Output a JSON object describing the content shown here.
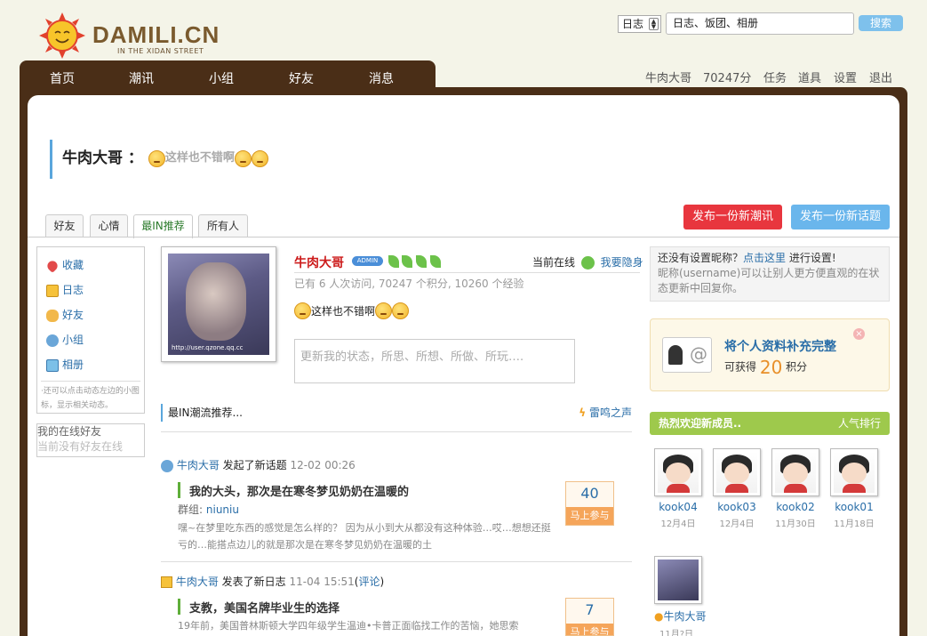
{
  "header": {
    "logo_text": "DAMILI.CN",
    "logo_sub": "IN THE XIDAN STREET",
    "search_type": "日志",
    "search_value": "日志、饭团、相册",
    "search_button": "搜索"
  },
  "nav": {
    "items": [
      {
        "label": "首页"
      },
      {
        "label": "潮讯"
      },
      {
        "label": "小组"
      },
      {
        "label": "好友"
      },
      {
        "label": "消息"
      }
    ]
  },
  "user_links": {
    "username": "牛肉大哥",
    "points": "70247分",
    "tasks": "任务",
    "props": "道具",
    "settings": "设置",
    "logout": "退出"
  },
  "profile_header": {
    "name": "牛肉大哥",
    "colon": "：",
    "status_text": "这样也不错啊"
  },
  "tabs": [
    {
      "label": "好友"
    },
    {
      "label": "心情"
    },
    {
      "label": "最IN推荐"
    },
    {
      "label": "所有人"
    }
  ],
  "buttons": {
    "post_news": "发布一份新潮讯",
    "post_topic": "发布一份新话题"
  },
  "left_menu": {
    "items": [
      {
        "label": "收藏",
        "icon": "heart-icon"
      },
      {
        "label": "日志",
        "icon": "notebook-icon"
      },
      {
        "label": "好友",
        "icon": "handshake-icon"
      },
      {
        "label": "小组",
        "icon": "group-icon"
      },
      {
        "label": "相册",
        "icon": "photo-icon"
      }
    ],
    "note": "·还可以点击动态左边的小图标，显示相关动态。"
  },
  "online_friends": {
    "title": "我的在线好友",
    "empty": "当前没有好友在线"
  },
  "profile": {
    "name": "牛肉大哥",
    "badge": "ADMIN",
    "stats": "已有 6 人次访问, 70247 个积分, 10260 个经验",
    "online_label": "当前在线",
    "hide_link": "我要隐身",
    "status": "这样也不错啊",
    "status_placeholder": "更新我的状态，所思、所想、所做、所玩….",
    "avatar_caption": "http://user.qzone.qq.cc"
  },
  "feed": {
    "title": "最IN潮流推荐...",
    "right_link": "雷鸣之声",
    "items": [
      {
        "user": "牛肉大哥",
        "action": "发起了新话题",
        "time": "12-02 00:26",
        "title": "我的大头，那次是在寒冬梦见奶奶在温暖的",
        "group_label": "群组:",
        "group": "niuniu",
        "excerpt": "嘿~在梦里吃东西的感觉是怎么样的？ 因为从小到大从都没有这种体验…哎…想想还挺亏的…能搭点边儿的就是那次是在寒冬梦见奶奶在温暖的土",
        "votes": "40",
        "vote_label": "马上参与"
      },
      {
        "user": "牛肉大哥",
        "action": "发表了新日志",
        "time": "11-04 15:51",
        "comment_open": "(",
        "comment": "评论",
        "comment_close": ")",
        "title": "支教，美国名牌毕业生的选择",
        "excerpt": "19年前，美国普林斯顿大学四年级学生温迪•卡普正面临找工作的苦恼，她思索",
        "votes": "7",
        "vote_label": "马上参与"
      }
    ]
  },
  "sidebar": {
    "nickname_notice_a": "还没有设置昵称？",
    "nickname_link": "点击这里",
    "nickname_notice_b": "进行设置!",
    "nickname_desc": "昵称(username)可以让别人更方便直观的在状态更新中回复你。",
    "complete_title": "将个人资料补充完整",
    "complete_reward_a": "可获得",
    "complete_points": "20",
    "complete_reward_b": "积分",
    "new_members_title": "热烈欢迎新成员..",
    "popularity_link": "人气排行",
    "members": [
      {
        "name": "kook04",
        "date": "12月4日"
      },
      {
        "name": "kook03",
        "date": "12月4日"
      },
      {
        "name": "kook02",
        "date": "11月30日"
      },
      {
        "name": "kook01",
        "date": "11月18日"
      },
      {
        "name": "牛肉大哥",
        "date": "11月?日"
      }
    ]
  },
  "colors": {
    "brown": "#4a2e17",
    "accent_blue": "#5aa6dc",
    "red_button": "#e8363e",
    "blue_button": "#6ab6ec",
    "green_bar": "#9ec94c"
  }
}
